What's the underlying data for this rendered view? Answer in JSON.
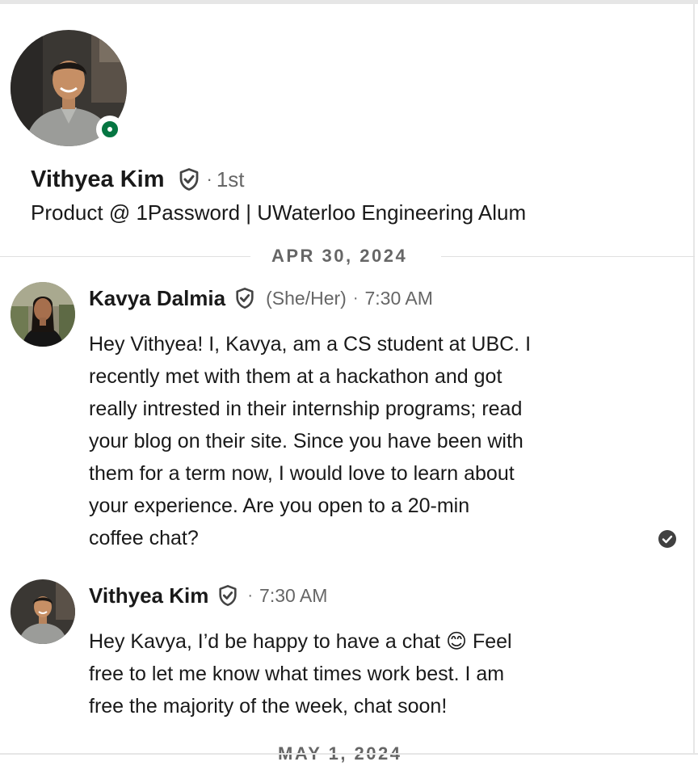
{
  "profile": {
    "name": "Vithyea Kim",
    "connection_degree": "1st",
    "headline": "Product @ 1Password | UWaterloo Engineering Alum",
    "online": true
  },
  "separator": "·",
  "dividers": {
    "first": "APR 30, 2024",
    "second": "MAY 1, 2024"
  },
  "messages": [
    {
      "sender": "Kavya Dalmia",
      "pronouns": "(She/Her)",
      "time": "7:30 AM",
      "body_lines": [
        "Hey Vithyea! I, Kavya, am a CS student at UBC. I",
        "recently met with them at a hackathon and got",
        "really intrested in their internship programs; read",
        "your blog on their site. Since you have been with",
        "them for a term now, I would love to learn about",
        "your experience. Are you open to a 20-min",
        "coffee chat?"
      ],
      "read": true
    },
    {
      "sender": "Vithyea Kim",
      "time": "7:30 AM",
      "body_lines": [
        "Hey Kavya, I’d be happy to have a chat 😊 Feel",
        "free to let me know what times work best. I am",
        "free the majority of the week, chat soon!"
      ]
    }
  ],
  "colors": {
    "online_green": "#057642",
    "muted_text": "#666666",
    "divider": "#e0e0e0"
  },
  "icons": {
    "verified": "verified-shield-icon",
    "read_receipt": "check-circle-icon"
  }
}
